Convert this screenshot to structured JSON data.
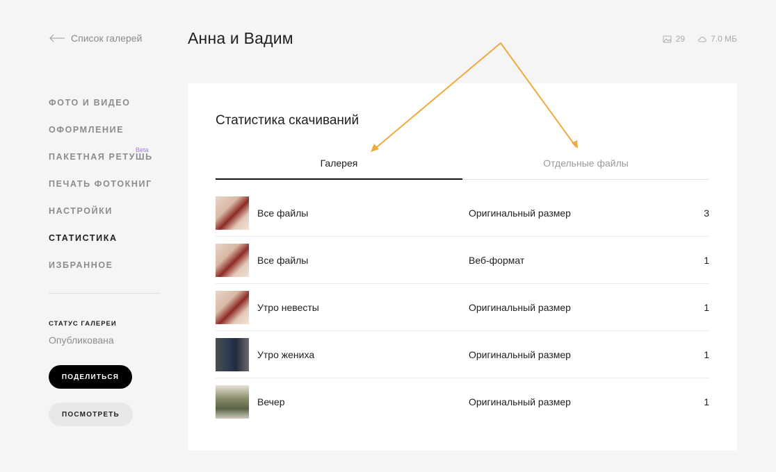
{
  "header": {
    "back_label": "Список галерей",
    "title": "Анна и Вадим",
    "photo_count": "29",
    "storage_size": "7.0 МБ"
  },
  "sidebar": {
    "items": [
      {
        "label": "Фото и видео",
        "active": false
      },
      {
        "label": "Оформление",
        "active": false
      },
      {
        "label": "Пакетная ретушь",
        "active": false,
        "badge": "Beta"
      },
      {
        "label": "Печать фотокниг",
        "active": false
      },
      {
        "label": "Настройки",
        "active": false
      },
      {
        "label": "Статистика",
        "active": true
      },
      {
        "label": "Избранное",
        "active": false
      }
    ],
    "status_label": "Статус галереи",
    "status_value": "Опубликована",
    "share_label": "Поделиться",
    "view_label": "Посмотреть"
  },
  "stats": {
    "title": "Статистика скачиваний",
    "tabs": [
      {
        "label": "Галерея",
        "active": true
      },
      {
        "label": "Отдельные файлы",
        "active": false
      }
    ],
    "rows": [
      {
        "name": "Все файлы",
        "format": "Оригинальный размер",
        "count": "3",
        "thumb": "rings"
      },
      {
        "name": "Все файлы",
        "format": "Веб-формат",
        "count": "1",
        "thumb": "rings"
      },
      {
        "name": "Утро невесты",
        "format": "Оригинальный размер",
        "count": "1",
        "thumb": "rings"
      },
      {
        "name": "Утро жениха",
        "format": "Оригинальный размер",
        "count": "1",
        "thumb": "groom"
      },
      {
        "name": "Вечер",
        "format": "Оригинальный размер",
        "count": "1",
        "thumb": "evening"
      }
    ]
  },
  "colors": {
    "annotation_arrow": "#f0a93c",
    "beta_badge": "#a47bd6",
    "background": "#f5f5f5"
  }
}
